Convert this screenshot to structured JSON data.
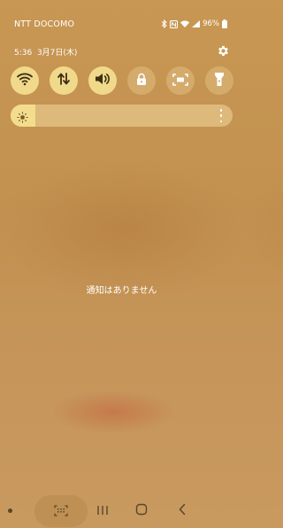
{
  "status_bar": {
    "carrier": "NTT DOCOMO",
    "battery_percent": "96%",
    "icons": [
      "bluetooth-icon",
      "nfc-icon",
      "wifi-icon",
      "signal-icon",
      "battery-icon"
    ]
  },
  "header": {
    "time": "5:36",
    "date": "3月7日(木)",
    "settings_icon": "gear-icon"
  },
  "quick_settings": [
    {
      "name": "wifi",
      "icon": "wifi-icon",
      "state": "on"
    },
    {
      "name": "mobile-data",
      "icon": "data-arrows-icon",
      "state": "on"
    },
    {
      "name": "sound",
      "icon": "speaker-icon",
      "state": "on"
    },
    {
      "name": "rotation-lock",
      "icon": "lock-icon",
      "state": "off"
    },
    {
      "name": "screenshot-capture",
      "icon": "capture-icon",
      "state": "off"
    },
    {
      "name": "flashlight",
      "icon": "flashlight-icon",
      "state": "off"
    }
  ],
  "brightness": {
    "level": 0.11,
    "icon": "sun-icon",
    "more_icon": "more-vertical-icon"
  },
  "notifications": {
    "empty_text": "通知はありません"
  },
  "nav_bar": {
    "buttons": [
      "dot-indicator",
      "keyboard-icon",
      "recent-apps-icon",
      "home-icon",
      "back-icon"
    ]
  },
  "colors": {
    "background": "#c89753",
    "tile_on": "#f1d98b",
    "tile_off": "#d5ab6c",
    "brightness_track": "#ddb97b",
    "brightness_fill": "#f3dd8d"
  }
}
